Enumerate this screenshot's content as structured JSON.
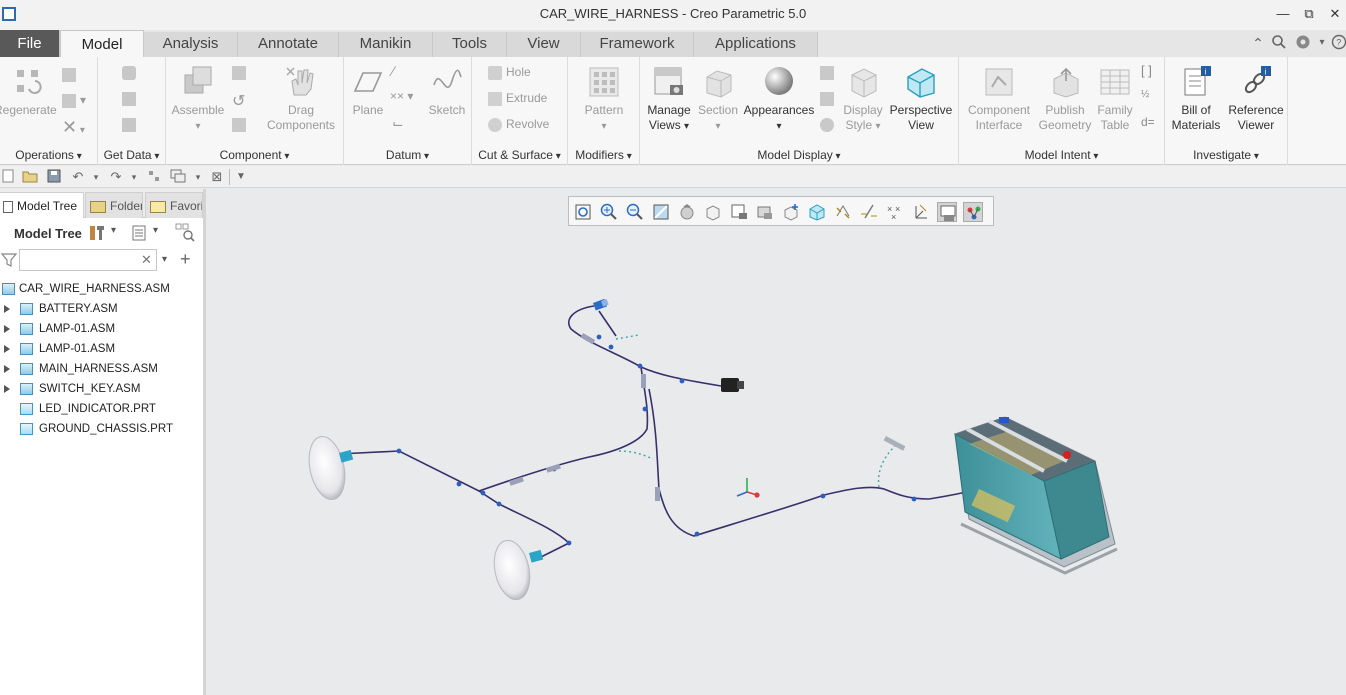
{
  "window": {
    "title": "CAR_WIRE_HARNESS - Creo Parametric 5.0",
    "minimize": "—",
    "restore": "⧉",
    "close": "✕"
  },
  "tabs": [
    {
      "label": "File"
    },
    {
      "label": "Model"
    },
    {
      "label": "Analysis"
    },
    {
      "label": "Annotate"
    },
    {
      "label": "Manikin"
    },
    {
      "label": "Tools"
    },
    {
      "label": "View"
    },
    {
      "label": "Framework"
    },
    {
      "label": "Applications"
    }
  ],
  "ribbon": {
    "operations": {
      "label": "Operations",
      "regenerate": "Regenerate"
    },
    "get_data": {
      "label": "Get Data"
    },
    "component": {
      "label": "Component",
      "assemble": "Assemble",
      "drag_line1": "Drag",
      "drag_line2": "Components"
    },
    "datum": {
      "label": "Datum",
      "plane": "Plane",
      "sketch": "Sketch"
    },
    "cut_surface": {
      "label": "Cut & Surface",
      "hole": "Hole",
      "extrude": "Extrude",
      "revolve": "Revolve"
    },
    "modifiers": {
      "label": "Modifiers",
      "pattern": "Pattern"
    },
    "model_display": {
      "label": "Model Display",
      "manage_line1": "Manage",
      "manage_line2": "Views",
      "section": "Section",
      "appearances": "Appearances",
      "display_line1": "Display",
      "display_line2": "Style",
      "perspective_line1": "Perspective",
      "perspective_line2": "View"
    },
    "model_intent": {
      "label": "Model Intent",
      "ci_line1": "Component",
      "ci_line2": "Interface",
      "pg_line1": "Publish",
      "pg_line2": "Geometry",
      "ft_line1": "Family",
      "ft_line2": "Table"
    },
    "investigate": {
      "label": "Investigate",
      "bom_line1": "Bill of",
      "bom_line2": "Materials",
      "rv_line1": "Reference",
      "rv_line2": "Viewer"
    }
  },
  "left_panel": {
    "tabs": [
      {
        "label": "Model Tree"
      },
      {
        "label": "Folder"
      },
      {
        "label": "Favorites"
      }
    ],
    "header": "Model Tree",
    "search": {
      "value": "",
      "placeholder": ""
    },
    "tree": [
      {
        "label": "CAR_WIRE_HARNESS.ASM",
        "level": 0,
        "expandable": false
      },
      {
        "label": "BATTERY.ASM",
        "level": 1,
        "expandable": true
      },
      {
        "label": "LAMP-01.ASM",
        "level": 1,
        "expandable": true
      },
      {
        "label": "LAMP-01.ASM",
        "level": 1,
        "expandable": true
      },
      {
        "label": "MAIN_HARNESS.ASM",
        "level": 1,
        "expandable": true
      },
      {
        "label": "SWITCH_KEY.ASM",
        "level": 1,
        "expandable": true
      },
      {
        "label": "LED_INDICATOR.PRT",
        "level": 1,
        "expandable": false
      },
      {
        "label": "GROUND_CHASSIS.PRT",
        "level": 1,
        "expandable": false
      }
    ]
  },
  "colors": {
    "file_tab": "#595959",
    "wire": "#3a2f6b",
    "node": "#2d5fc0",
    "battery_body": "#4a9aa3",
    "battery_terminal": "#d62020",
    "lamp": "#f0f0f2",
    "connector": "#2aa4c8"
  }
}
